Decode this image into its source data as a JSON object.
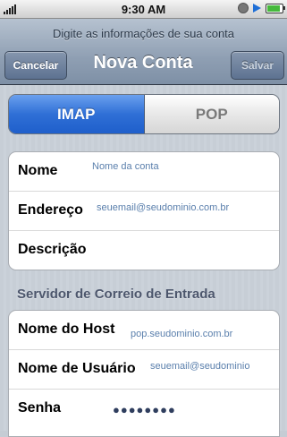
{
  "status_bar": {
    "time": "9:30 AM"
  },
  "nav": {
    "prompt": "Digite as informações de sua conta",
    "title": "Nova Conta",
    "cancel_label": "Cancelar",
    "save_label": "Salvar"
  },
  "segments": {
    "imap": "IMAP",
    "pop": "POP",
    "selected": "IMAP"
  },
  "account_group": [
    {
      "label": "Nome",
      "value": "Nome da conta"
    },
    {
      "label": "Endereço",
      "value": "seuemail@seudominio.com.br"
    },
    {
      "label": "Descrição",
      "value": ""
    }
  ],
  "incoming_section": {
    "header": "Servidor de Correio de Entrada",
    "rows": [
      {
        "label": "Nome do Host",
        "value": "pop.seudominio.com.br"
      },
      {
        "label": "Nome de Usuário",
        "value": "seuemail@seudominio"
      },
      {
        "label": "Senha",
        "value": "●●●●●●●●"
      }
    ]
  },
  "colors": {
    "accent": "#2f6fd6",
    "value_text": "#5a7fac"
  }
}
